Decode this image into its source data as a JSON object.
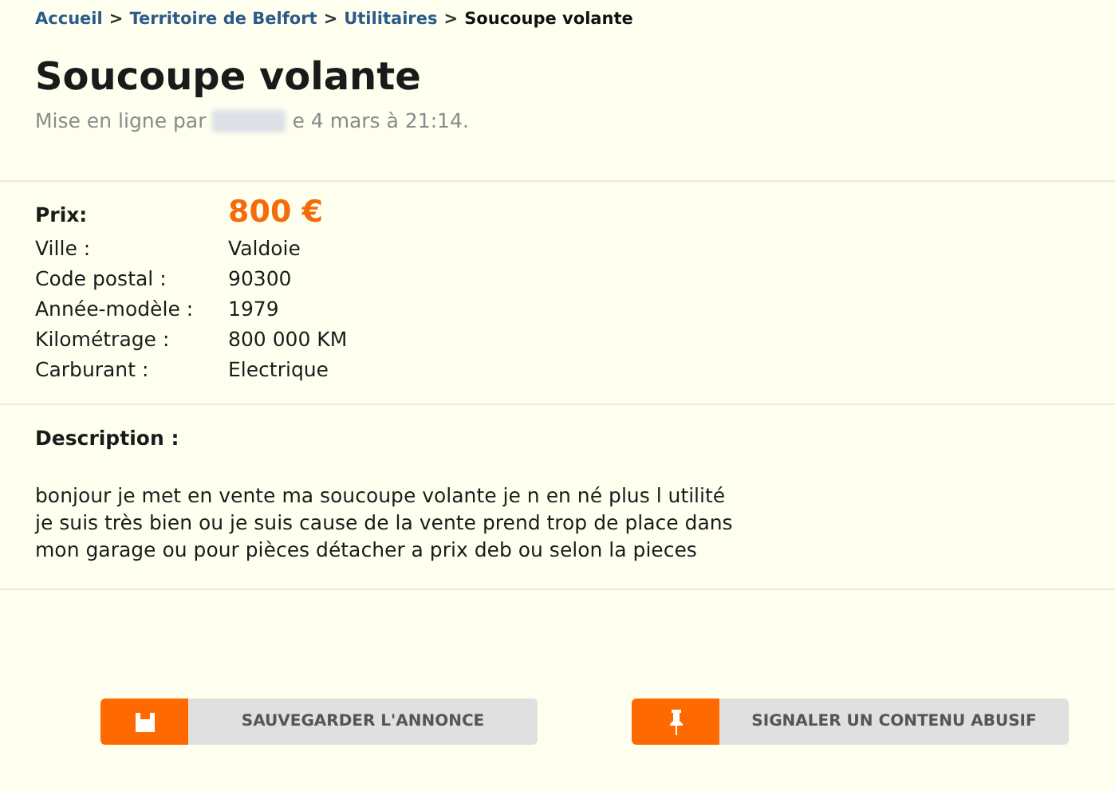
{
  "breadcrumb": [
    {
      "label": "Accueil",
      "kind": "link"
    },
    {
      "label": "Territoire de Belfort",
      "kind": "link"
    },
    {
      "label": "Utilitaires",
      "kind": "link"
    },
    {
      "label": "Soucoupe volante",
      "kind": "current"
    }
  ],
  "separator": ">",
  "title": "Soucoupe volante",
  "posted": {
    "before": "Mise en ligne par",
    "after": "e 4 mars à 21:14."
  },
  "price": {
    "label": "Prix:",
    "value": "800 €"
  },
  "details": [
    {
      "label": "Ville :",
      "value": "Valdoie"
    },
    {
      "label": "Code postal :",
      "value": "90300"
    },
    {
      "label": "Année-modèle :",
      "value": "1979"
    },
    {
      "label": "Kilométrage :",
      "value": "800 000 KM"
    },
    {
      "label": "Carburant :",
      "value": "Electrique"
    }
  ],
  "description": {
    "heading": "Description :",
    "lines": [
      "bonjour je met en vente ma soucoupe volante je n en né plus l utilité",
      "je suis très bien ou je suis cause de la vente prend trop de place dans",
      "mon garage ou pour pièces détacher a prix deb ou selon la pieces"
    ]
  },
  "buttons": [
    {
      "label": "SAUVEGARDER L'ANNONCE",
      "kind": "save"
    },
    {
      "label": "SIGNALER UN CONTENU ABUSIF",
      "kind": "report"
    }
  ]
}
